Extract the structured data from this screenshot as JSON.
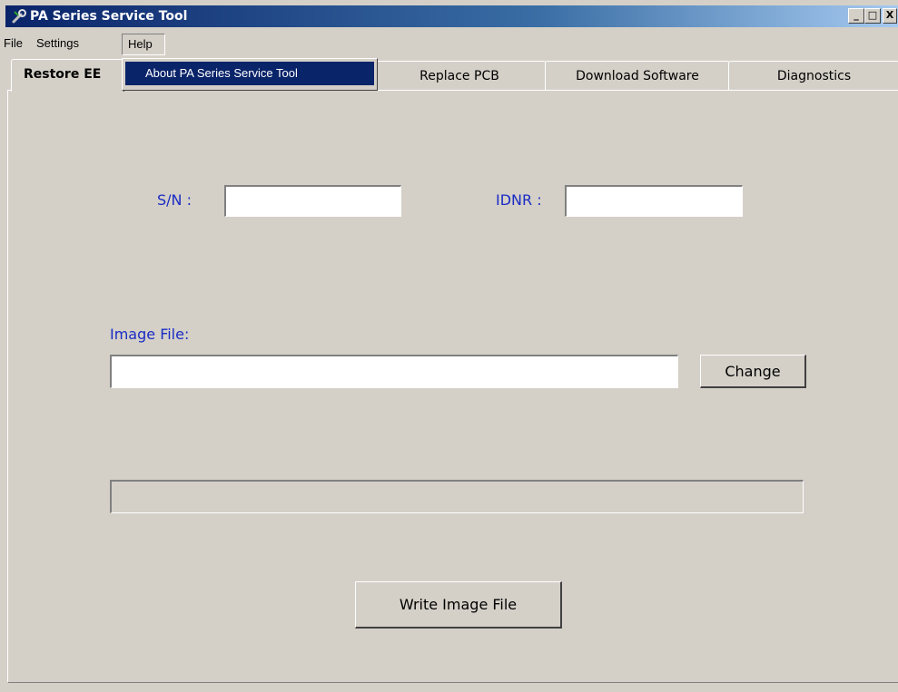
{
  "window": {
    "title": "PA Series Service Tool",
    "controls": {
      "minimize": "_",
      "maximize": "□",
      "close": "X"
    }
  },
  "menubar": {
    "items": [
      {
        "label": "File"
      },
      {
        "label": "Settings"
      },
      {
        "label": "Help"
      }
    ],
    "help_dropdown": {
      "items": [
        {
          "label": "About PA Series Service Tool"
        }
      ]
    }
  },
  "tabs": [
    {
      "label": "Restore EE",
      "active": true
    },
    {
      "label": "Replace PCB",
      "active": false
    },
    {
      "label": "Download Software",
      "active": false
    },
    {
      "label": "Diagnostics",
      "active": false
    }
  ],
  "form": {
    "sn_label": "S/N :",
    "sn_value": "",
    "idnr_label": "IDNR :",
    "idnr_value": "",
    "image_file_label": "Image File:",
    "image_file_value": "",
    "change_button": "Change",
    "write_button": "Write Image File"
  },
  "progress": {
    "value": 0
  },
  "colors": {
    "label_blue": "#1a2bc4",
    "titlebar_start": "#0a246a",
    "titlebar_end": "#a6caf0",
    "window_bg": "#d4d0c8"
  },
  "icons": {
    "app": "wrench-icon"
  }
}
